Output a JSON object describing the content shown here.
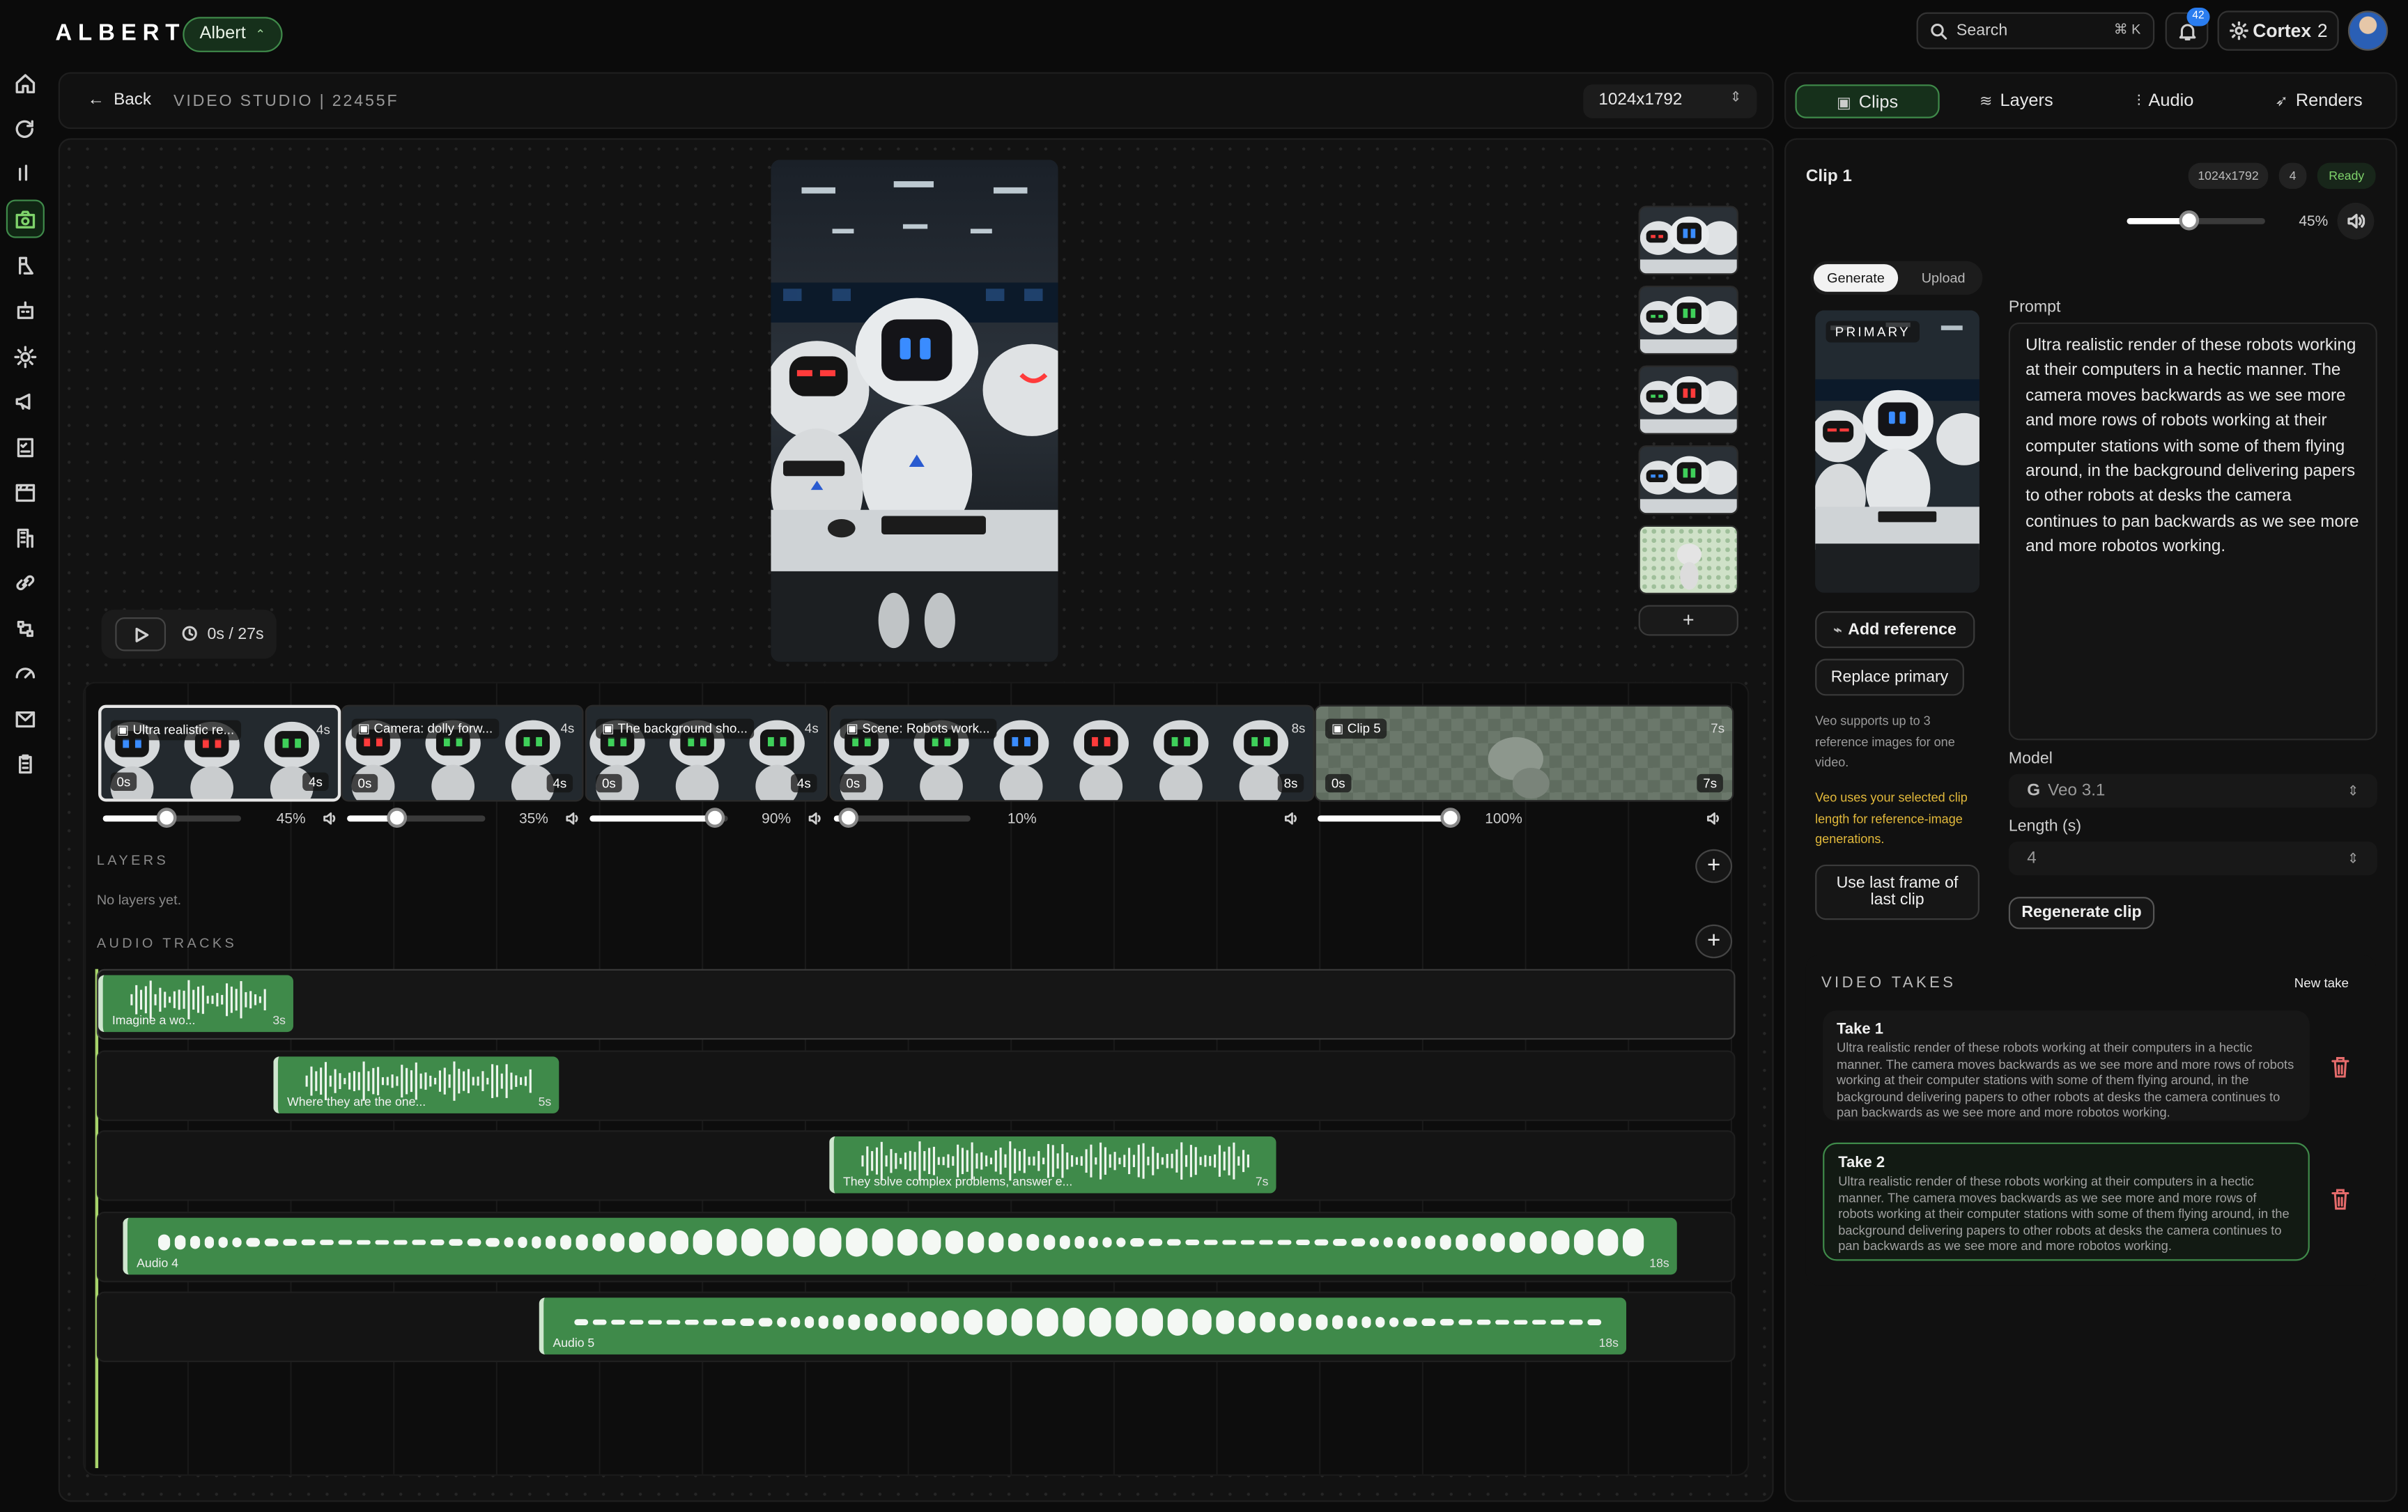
{
  "app": {
    "name": "ALBERT",
    "account": "Albert"
  },
  "header": {
    "search_label": "Search",
    "search_shortcut": "⌘ K",
    "notifications": "42",
    "workspace": "Cortex",
    "workspace_count": "2"
  },
  "sidebar": {
    "items": [
      "home-icon",
      "refresh-icon",
      "analytics-icon",
      "video-studio-icon",
      "brain-icon",
      "bot-icon",
      "settings-icon",
      "megaphone-icon",
      "checklist-icon",
      "clapper-icon",
      "building-icon",
      "link-icon",
      "flow-icon",
      "gauge-icon",
      "mail-icon",
      "clipboard-icon"
    ],
    "active": 3
  },
  "studio": {
    "back_label": "Back",
    "title": "VIDEO STUDIO | 22455F",
    "resolution": "1024x1792",
    "time": "0s / 27s"
  },
  "timeline": {
    "clips": [
      {
        "title": "Ultra realistic re...",
        "length": "4s",
        "start": "0s",
        "end": "4s",
        "volume": "45%",
        "volume_value": 45,
        "selected": true
      },
      {
        "title": "Camera: dolly forw...",
        "length": "4s",
        "start": "0s",
        "end": "4s",
        "volume": "35%",
        "volume_value": 35,
        "selected": false
      },
      {
        "title": "The background sho...",
        "length": "4s",
        "start": "0s",
        "end": "4s",
        "volume": "90%",
        "volume_value": 90,
        "selected": false
      },
      {
        "title": "Scene: Robots work...",
        "length": "8s",
        "start": "0s",
        "end": "8s",
        "volume": "10%",
        "volume_value": 10,
        "selected": false
      },
      {
        "title": "Clip 5",
        "length": "7s",
        "start": "0s",
        "end": "7s",
        "volume": "100%",
        "volume_value": 100,
        "selected": false
      }
    ],
    "layers_heading": "LAYERS",
    "layers_empty": "No layers yet.",
    "audio_heading": "AUDIO TRACKS",
    "audio": [
      {
        "name": "Imagine a wo...",
        "length": "3s"
      },
      {
        "name": "Where they are the one...",
        "length": "5s"
      },
      {
        "name": "They solve complex problems, answer e...",
        "length": "7s"
      },
      {
        "name": "Audio 4",
        "length": "18s"
      },
      {
        "name": "Audio 5",
        "length": "18s"
      }
    ]
  },
  "right": {
    "tabs": [
      "Clips",
      "Layers",
      "Audio",
      "Renders"
    ],
    "active_tab": 0,
    "clip_title": "Clip 1",
    "clip_resolution": "1024x1792",
    "clip_length": "4",
    "clip_status": "Ready",
    "volume": "45%",
    "volume_value": 45,
    "mode_generate": "Generate",
    "mode_upload": "Upload",
    "primary_label": "PRIMARY",
    "add_reference": "Add reference",
    "replace_primary": "Replace primary",
    "note_refs": "Veo supports up to 3 reference images for one video.",
    "note_length": "Veo uses your selected clip length for reference-image generations.",
    "use_last_frame": "Use last frame of last clip",
    "prompt_label": "Prompt",
    "prompt": "Ultra realistic render of these robots working at their computers in a hectic manner. The camera moves backwards as we see more and more rows of robots working at their computer stations with some of them flying around, in the background delivering papers to other robots at desks the camera continues to pan backwards as we see more and more robotos working.",
    "model_label": "Model",
    "model_value": "Veo 3.1",
    "length_label": "Length (s)",
    "length_value": "4",
    "regenerate": "Regenerate clip",
    "takes_heading": "VIDEO TAKES",
    "new_take": "New take",
    "takes": [
      {
        "title": "Take 1",
        "text": "Ultra realistic render of these robots working at their computers in a hectic manner. The camera moves backwards as we see more and more rows of robots working at their computer stations with some of them flying around, in the background delivering papers to other robots at desks the camera continues to pan backwards as we see more and more robotos working."
      },
      {
        "title": "Take 2",
        "text": "Ultra realistic render of these robots working at their computers in a hectic manner. The camera moves backwards as we see more and more rows of robots working at their computer stations with some of them flying around, in the background delivering papers to other robots at desks the camera continues to pan backwards as we see more and more robotos working."
      }
    ],
    "active_take": 1
  },
  "colors": {
    "accent": "#3f8a4a",
    "accent_bg": "#16301b",
    "playhead": "#a7d36b",
    "ready": "#7fd36b",
    "warning": "#e2b93b"
  }
}
